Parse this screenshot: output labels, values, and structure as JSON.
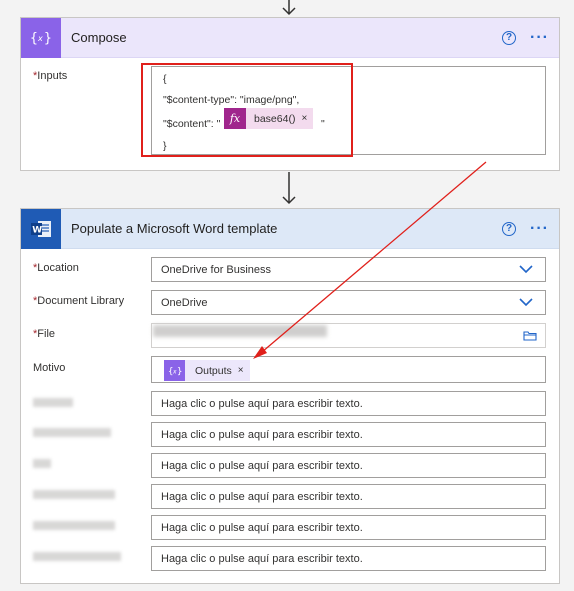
{
  "compose": {
    "title": "Compose",
    "help_glyph": "?",
    "more_glyph": "···",
    "inputs_label": "Inputs",
    "required_mark": "*",
    "code": {
      "open_brace": "{",
      "content_type_line": "\"$content-type\":  \"image/png\",",
      "content_key": "\"$content\": \"",
      "content_suffix": "\"",
      "close_brace": "}"
    },
    "expression_token": {
      "icon": "fx",
      "label": "base64()",
      "remove": "×"
    }
  },
  "word": {
    "title": "Populate a Microsoft Word template",
    "help_glyph": "?",
    "more_glyph": "···",
    "required_mark": "*",
    "location": {
      "label": "Location",
      "value": "OneDrive for Business"
    },
    "library": {
      "label": "Document Library",
      "value": "OneDrive"
    },
    "file": {
      "label": "File"
    },
    "motivo": {
      "label": "Motivo",
      "token_label": "Outputs",
      "token_remove": "×"
    },
    "placeholder_fields": [
      {
        "placeholder": "Haga clic o pulse aquí para escribir texto."
      },
      {
        "placeholder": "Haga clic o pulse aquí para escribir texto."
      },
      {
        "placeholder": "Haga clic o pulse aquí para escribir texto."
      },
      {
        "placeholder": "Haga clic o pulse aquí para escribir texto."
      },
      {
        "placeholder": "Haga clic o pulse aquí para escribir texto."
      },
      {
        "placeholder": "Haga clic o pulse aquí para escribir texto."
      }
    ]
  },
  "colors": {
    "compose_accent": "#8a63e8",
    "word_accent": "#1f5bb5",
    "annotation_red": "#e0201b",
    "expression_accent": "#a0268d"
  }
}
